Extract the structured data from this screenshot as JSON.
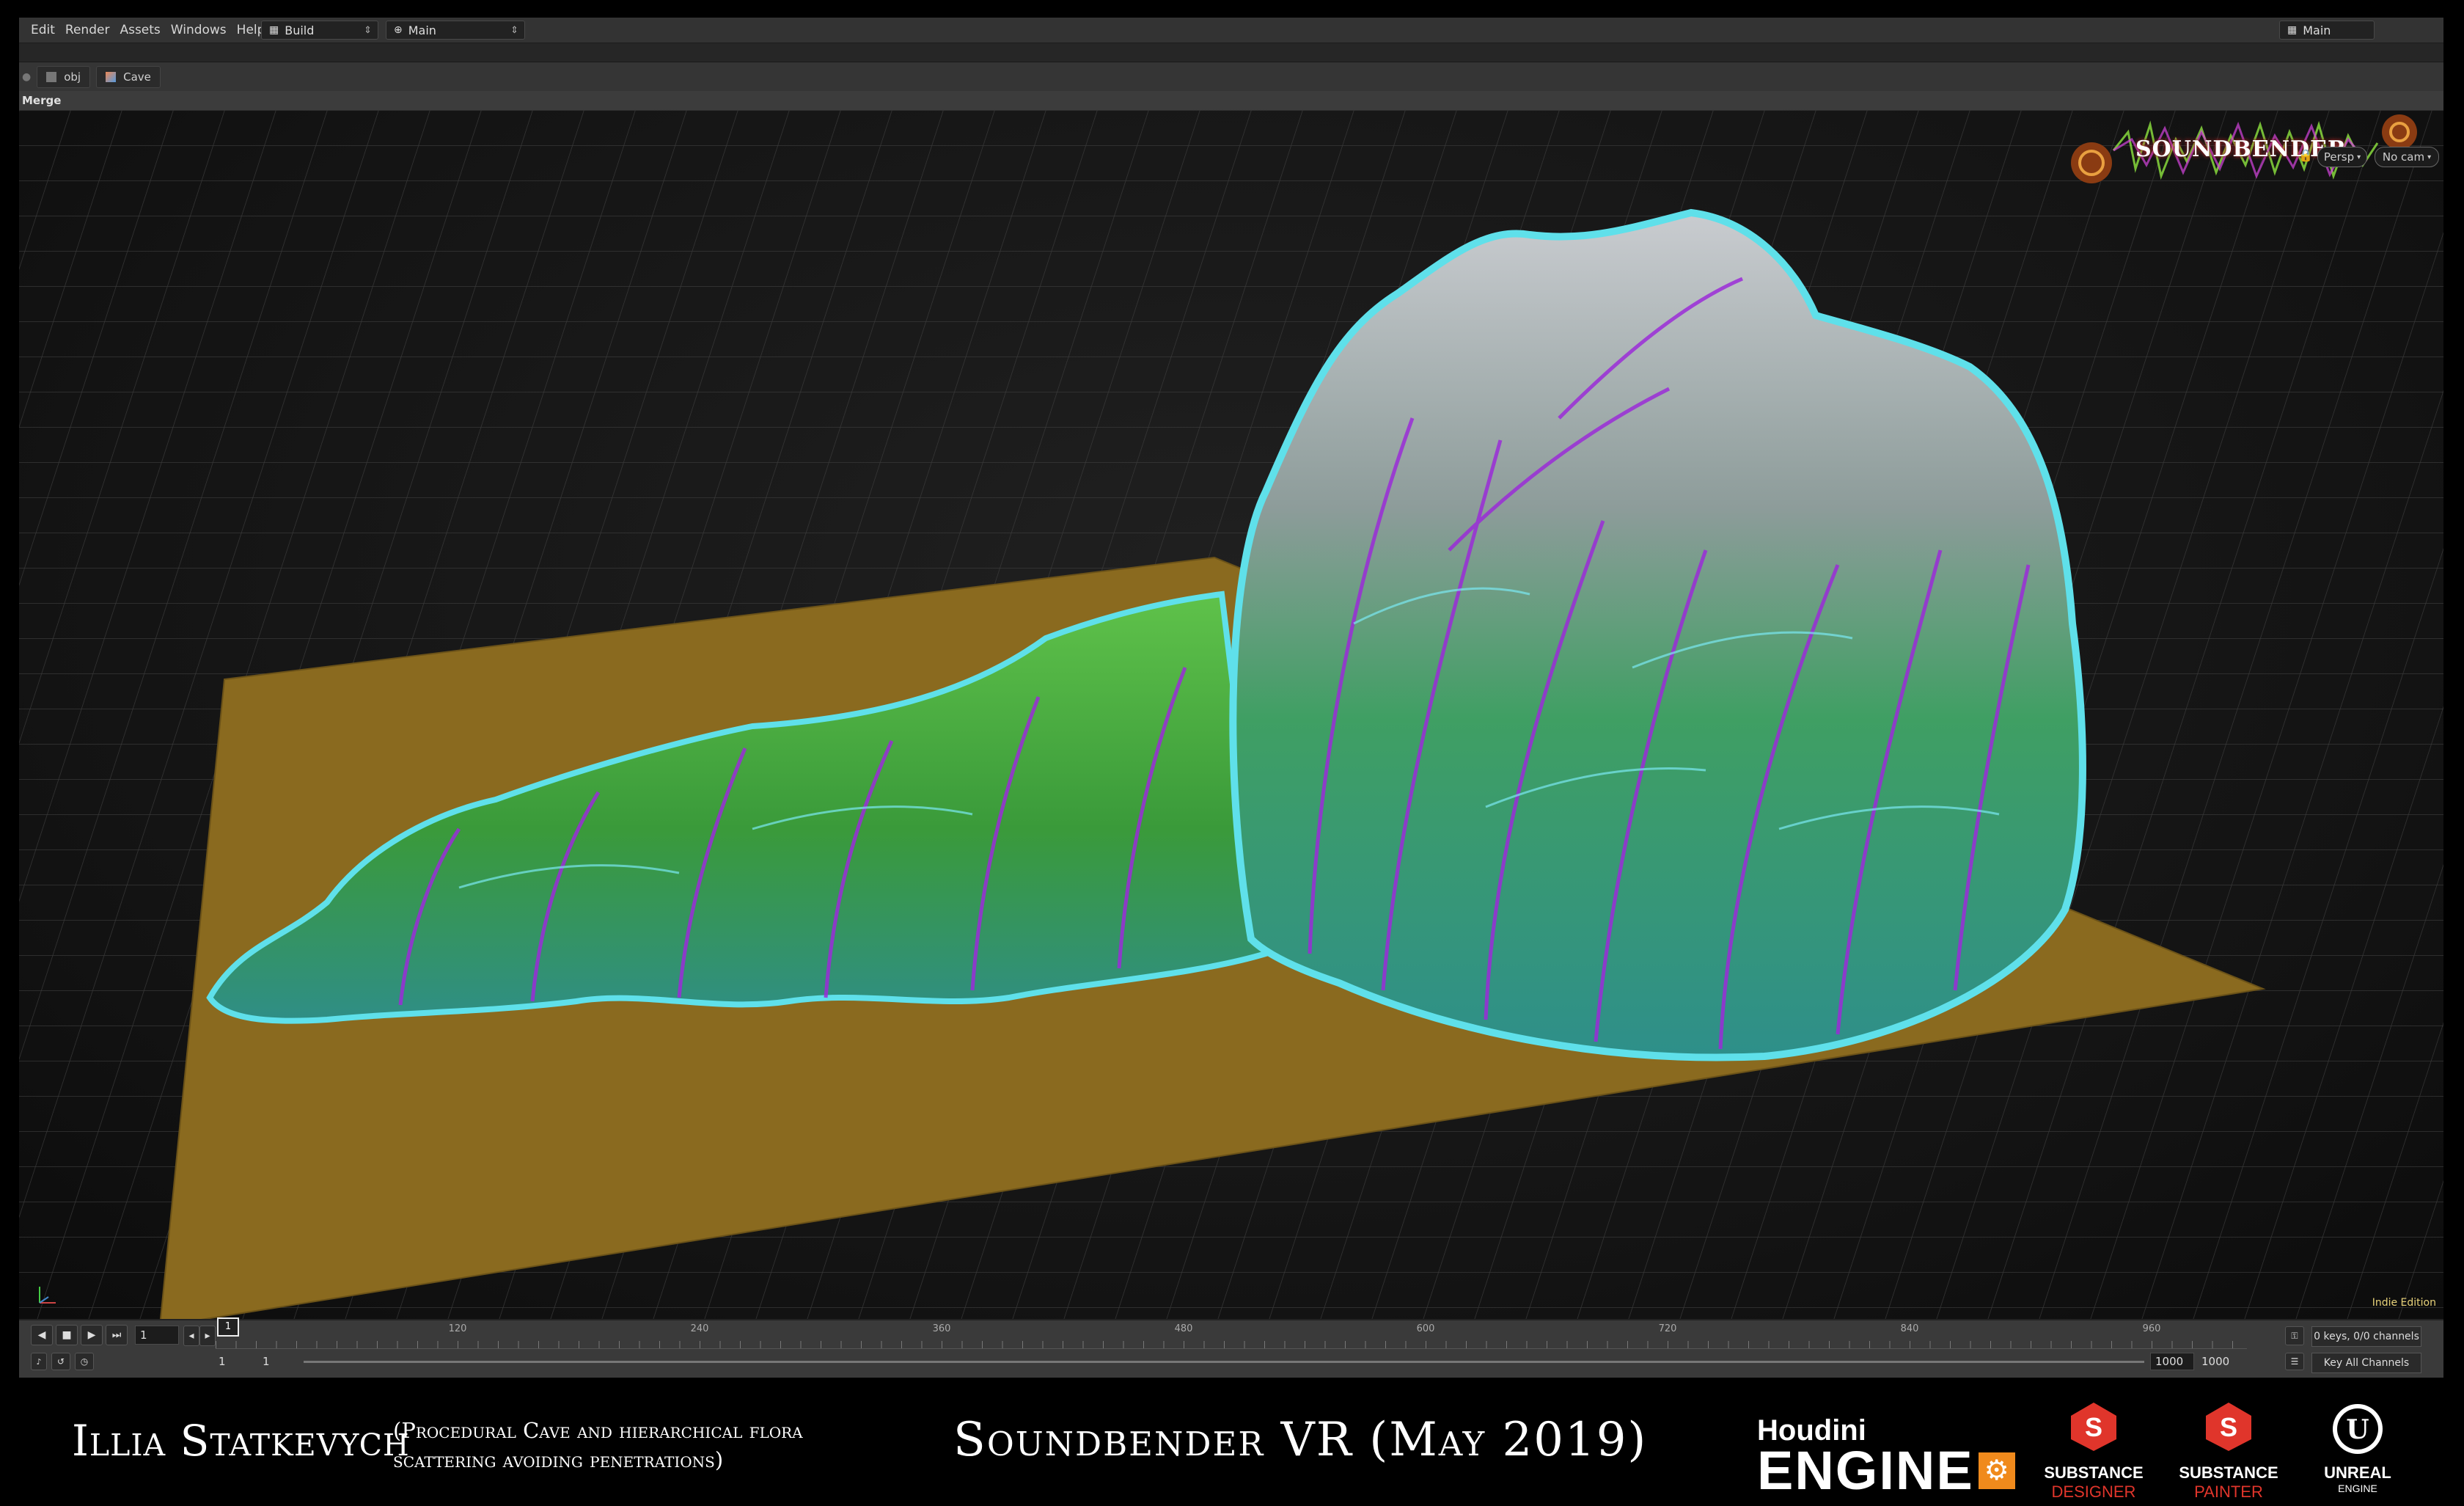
{
  "menubar": {
    "items": [
      "Edit",
      "Render",
      "Assets",
      "Windows",
      "Help"
    ],
    "desktop": "Build",
    "layout": "Main",
    "right_tab": "Main"
  },
  "pathbar": {
    "items": [
      "obj",
      "Cave"
    ]
  },
  "operator_label": "Merge",
  "viewport": {
    "camera_persp": "Persp",
    "camera_cam": "No cam",
    "watermark": "Indie Edition",
    "logo_text": "SOUNDBENDER"
  },
  "timeline": {
    "current_frame": "1",
    "start_frame": "1",
    "start_frame_2": "1",
    "end_frame": "1000",
    "end_frame_2": "1000",
    "frame_marker": "1",
    "tick_labels": [
      "120",
      "240",
      "360",
      "480",
      "600",
      "720",
      "840",
      "960"
    ],
    "keys_label": "0 keys, 0/0 channels",
    "key_all_label": "Key All Channels"
  },
  "caption": {
    "author": "Illia Statkevych",
    "description": "(Procedural Cave and hierarchical flora scattering avoiding penetrations)",
    "title": "Soundbender VR (May 2019)"
  },
  "logos": {
    "houdini_top": "Houdini",
    "houdini_bottom": "ENGINE",
    "designer_top": "SUBSTANCE",
    "designer_bottom": "DESIGNER",
    "painter_top": "SUBSTANCE",
    "painter_bottom": "PAINTER",
    "unreal_top": "UNREAL",
    "unreal_bottom": "ENGINE"
  },
  "colors": {
    "ground": "#8a6a1f",
    "terrain_green": "#3fae2f",
    "terrain_gray": "#9aa0a6",
    "vein_purple": "#9b2cd8",
    "vein_cyan": "#56e3ee",
    "designer_red": "#e0352b",
    "painter_red": "#e0352b"
  }
}
